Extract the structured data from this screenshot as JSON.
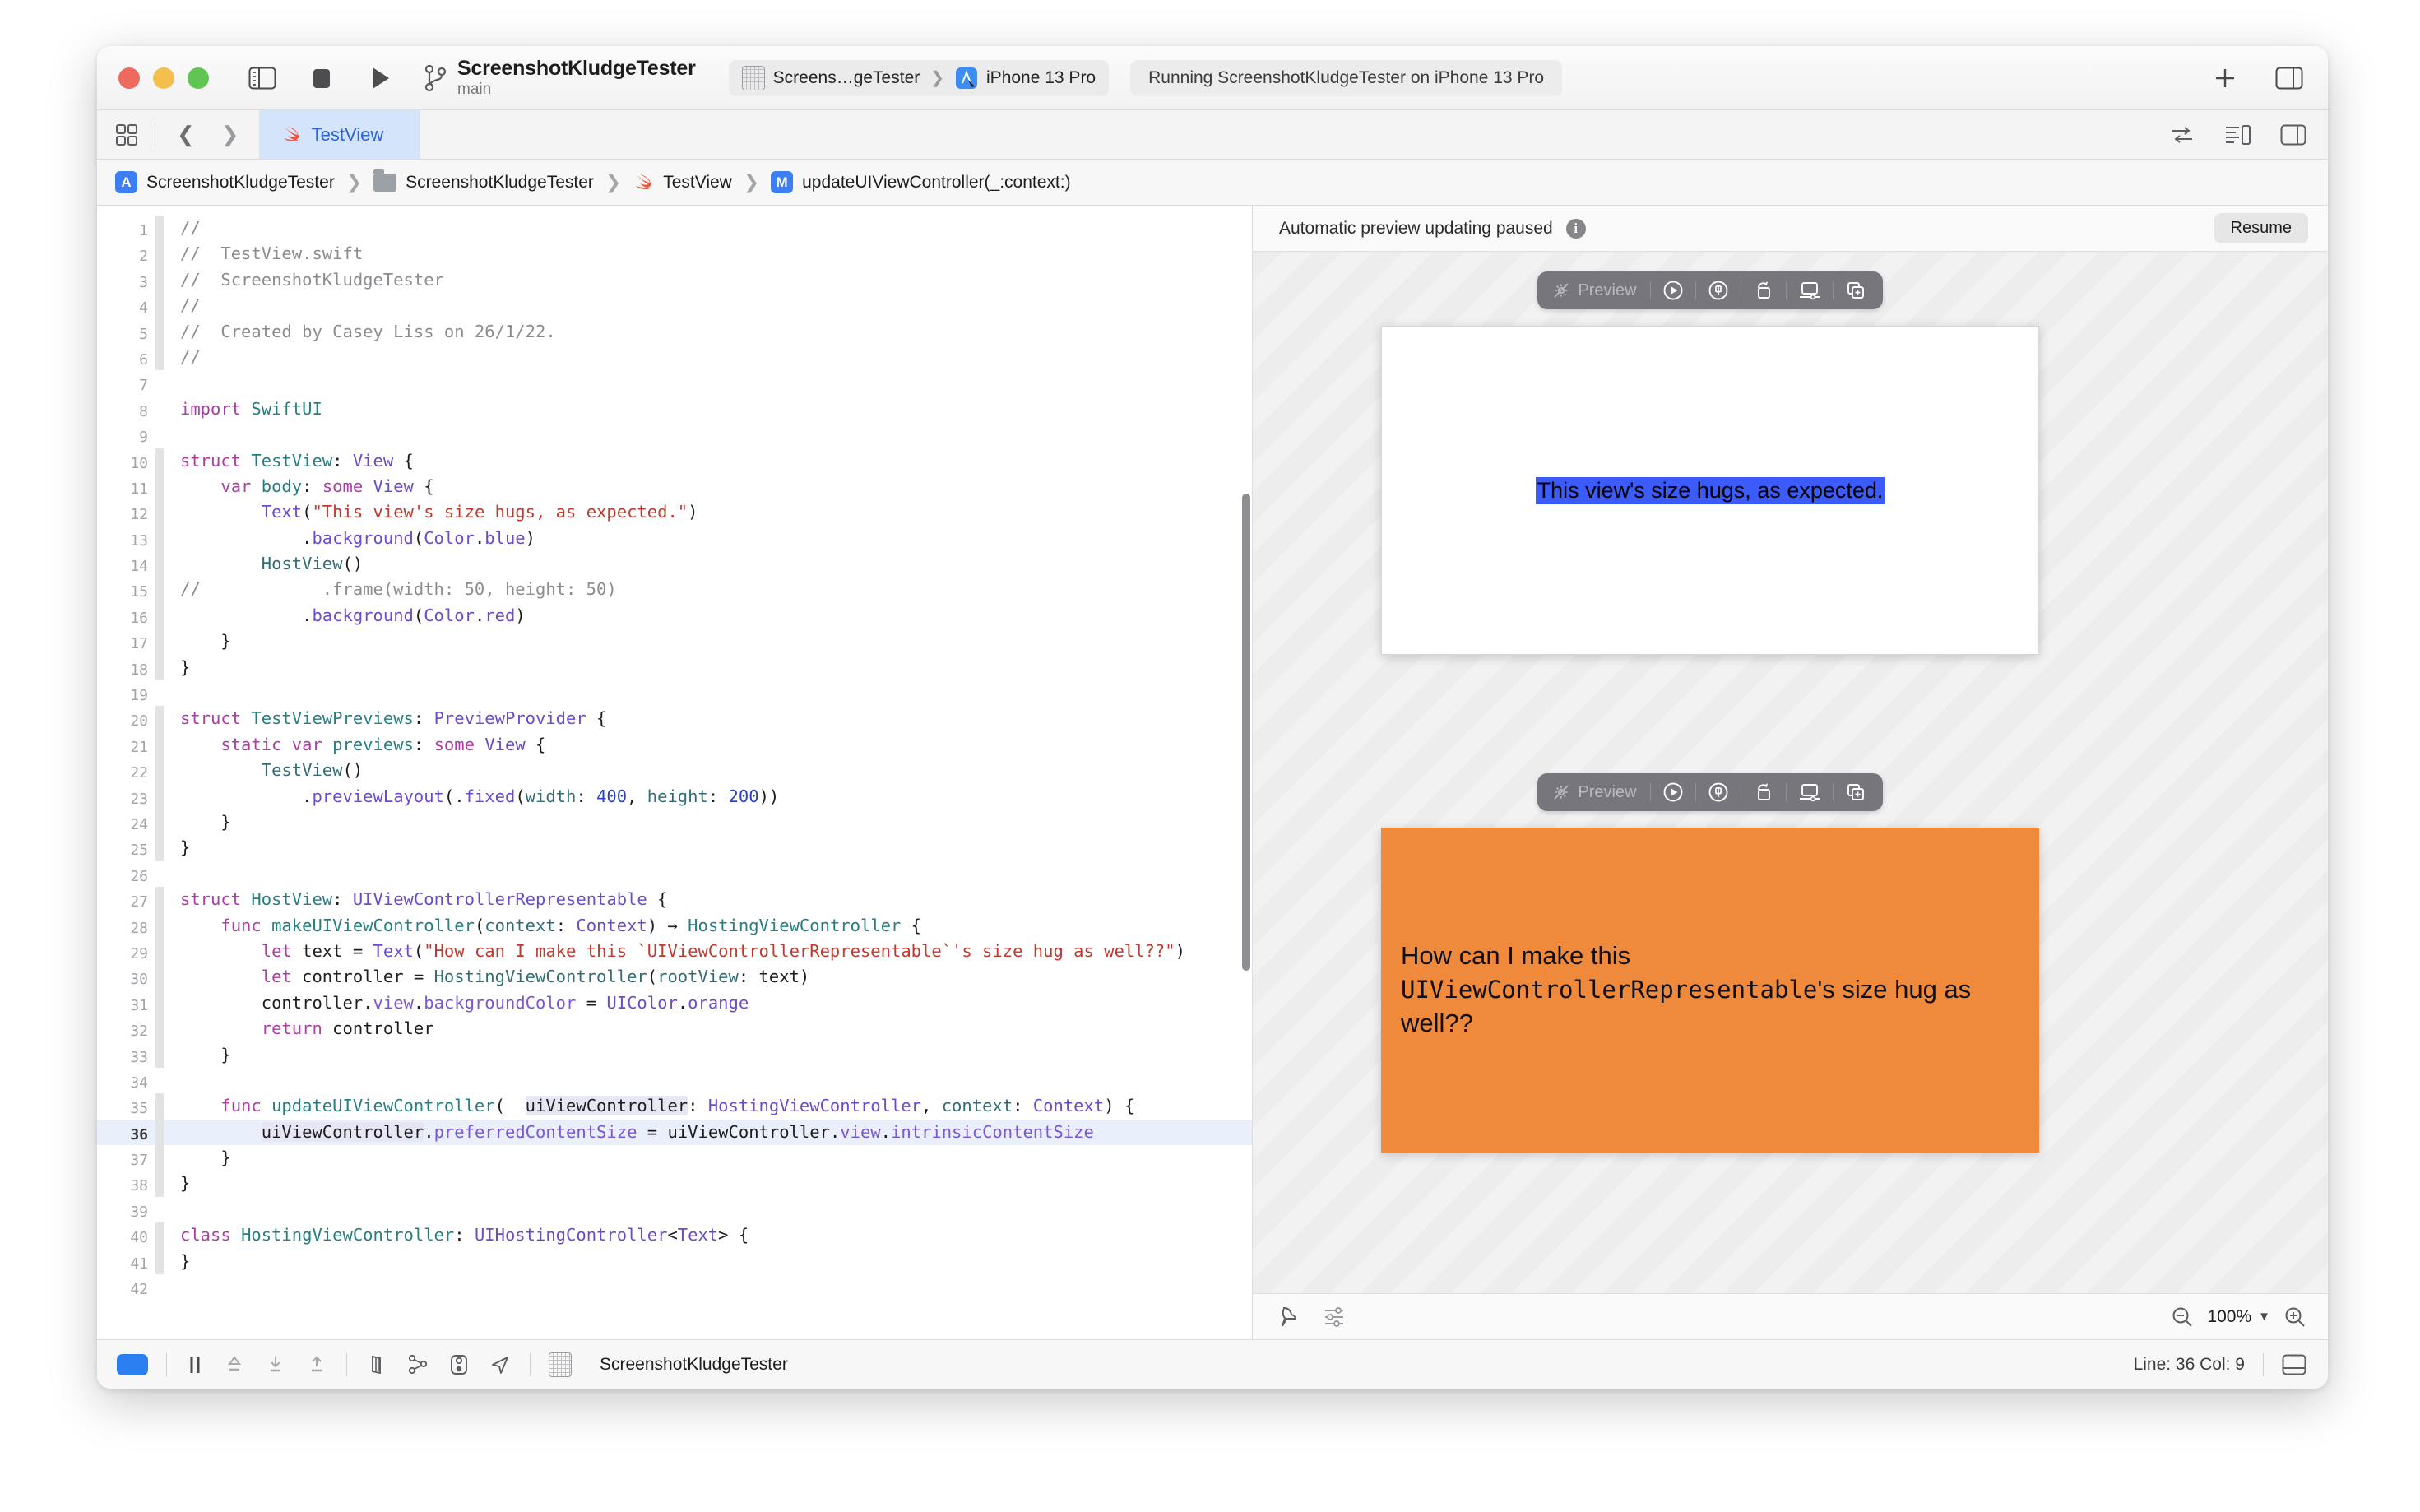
{
  "window": {
    "titlebar": {
      "scheme_title": "ScreenshotKludgeTester",
      "branch": "main",
      "scheme_name": "Screens…geTester",
      "destination": "iPhone 13 Pro",
      "status": "Running ScreenshotKludgeTester on iPhone 13 Pro",
      "add_label": "+"
    },
    "tabbar": {
      "tab_label": "TestView"
    },
    "jumpbar": {
      "crumbs": [
        {
          "label": "ScreenshotKludgeTester",
          "icon": "app-icon",
          "badge": "A"
        },
        {
          "label": "ScreenshotKludgeTester",
          "icon": "folder-icon",
          "badge": ""
        },
        {
          "label": "TestView",
          "icon": "swift-icon",
          "badge": ""
        },
        {
          "label": "updateUIViewController(_:context:)",
          "icon": "method-badge",
          "badge": "M"
        }
      ]
    }
  },
  "editor": {
    "lines": [
      {
        "n": 1,
        "fold": true,
        "tokens": [
          {
            "t": "//",
            "c": "cmt"
          }
        ]
      },
      {
        "n": 2,
        "fold": true,
        "tokens": [
          {
            "t": "//  TestView.swift",
            "c": "cmt"
          }
        ]
      },
      {
        "n": 3,
        "fold": true,
        "tokens": [
          {
            "t": "//  ScreenshotKludgeTester",
            "c": "cmt"
          }
        ]
      },
      {
        "n": 4,
        "fold": true,
        "tokens": [
          {
            "t": "//",
            "c": "cmt"
          }
        ]
      },
      {
        "n": 5,
        "fold": true,
        "tokens": [
          {
            "t": "//  Created by Casey Liss on 26/1/22.",
            "c": "cmt"
          }
        ]
      },
      {
        "n": 6,
        "fold": true,
        "tokens": [
          {
            "t": "//",
            "c": "cmt"
          }
        ]
      },
      {
        "n": 7,
        "fold": false,
        "tokens": []
      },
      {
        "n": 8,
        "fold": false,
        "tokens": [
          {
            "t": "import",
            "c": "kw"
          },
          {
            "t": " ",
            "c": "pln"
          },
          {
            "t": "SwiftUI",
            "c": "typ"
          }
        ]
      },
      {
        "n": 9,
        "fold": false,
        "tokens": []
      },
      {
        "n": 10,
        "fold": true,
        "tokens": [
          {
            "t": "struct",
            "c": "kw"
          },
          {
            "t": " ",
            "c": "pln"
          },
          {
            "t": "TestView",
            "c": "typ"
          },
          {
            "t": ": ",
            "c": "pln"
          },
          {
            "t": "View",
            "c": "meth"
          },
          {
            "t": " {",
            "c": "pln"
          }
        ]
      },
      {
        "n": 11,
        "fold": true,
        "tokens": [
          {
            "t": "    ",
            "c": "pln"
          },
          {
            "t": "var",
            "c": "kw"
          },
          {
            "t": " ",
            "c": "pln"
          },
          {
            "t": "body",
            "c": "typ"
          },
          {
            "t": ": ",
            "c": "pln"
          },
          {
            "t": "some",
            "c": "kw"
          },
          {
            "t": " ",
            "c": "pln"
          },
          {
            "t": "View",
            "c": "meth"
          },
          {
            "t": " {",
            "c": "pln"
          }
        ]
      },
      {
        "n": 12,
        "fold": true,
        "tokens": [
          {
            "t": "        ",
            "c": "pln"
          },
          {
            "t": "Text",
            "c": "meth"
          },
          {
            "t": "(",
            "c": "pln"
          },
          {
            "t": "\"This view's size hugs, as expected.\"",
            "c": "str"
          },
          {
            "t": ")",
            "c": "pln"
          }
        ]
      },
      {
        "n": 13,
        "fold": true,
        "tokens": [
          {
            "t": "            .",
            "c": "pln"
          },
          {
            "t": "background",
            "c": "meth"
          },
          {
            "t": "(",
            "c": "pln"
          },
          {
            "t": "Color",
            "c": "meth"
          },
          {
            "t": ".",
            "c": "pln"
          },
          {
            "t": "blue",
            "c": "meth"
          },
          {
            "t": ")",
            "c": "pln"
          }
        ]
      },
      {
        "n": 14,
        "fold": true,
        "tokens": [
          {
            "t": "        ",
            "c": "pln"
          },
          {
            "t": "HostView",
            "c": "ident"
          },
          {
            "t": "()",
            "c": "pln"
          }
        ]
      },
      {
        "n": 15,
        "fold": true,
        "tokens": [
          {
            "t": "//            .frame(width: 50, height: 50)",
            "c": "cmt"
          }
        ]
      },
      {
        "n": 16,
        "fold": true,
        "tokens": [
          {
            "t": "            .",
            "c": "pln"
          },
          {
            "t": "background",
            "c": "meth"
          },
          {
            "t": "(",
            "c": "pln"
          },
          {
            "t": "Color",
            "c": "meth"
          },
          {
            "t": ".",
            "c": "pln"
          },
          {
            "t": "red",
            "c": "meth"
          },
          {
            "t": ")",
            "c": "pln"
          }
        ]
      },
      {
        "n": 17,
        "fold": true,
        "tokens": [
          {
            "t": "    }",
            "c": "pln"
          }
        ]
      },
      {
        "n": 18,
        "fold": true,
        "tokens": [
          {
            "t": "}",
            "c": "pln"
          }
        ]
      },
      {
        "n": 19,
        "fold": false,
        "tokens": []
      },
      {
        "n": 20,
        "fold": true,
        "tokens": [
          {
            "t": "struct",
            "c": "kw"
          },
          {
            "t": " ",
            "c": "pln"
          },
          {
            "t": "TestViewPreviews",
            "c": "typ"
          },
          {
            "t": ": ",
            "c": "pln"
          },
          {
            "t": "PreviewProvider",
            "c": "meth"
          },
          {
            "t": " {",
            "c": "pln"
          }
        ]
      },
      {
        "n": 21,
        "fold": true,
        "tokens": [
          {
            "t": "    ",
            "c": "pln"
          },
          {
            "t": "static",
            "c": "kw"
          },
          {
            "t": " ",
            "c": "pln"
          },
          {
            "t": "var",
            "c": "kw"
          },
          {
            "t": " ",
            "c": "pln"
          },
          {
            "t": "previews",
            "c": "typ"
          },
          {
            "t": ": ",
            "c": "pln"
          },
          {
            "t": "some",
            "c": "kw"
          },
          {
            "t": " ",
            "c": "pln"
          },
          {
            "t": "View",
            "c": "meth"
          },
          {
            "t": " {",
            "c": "pln"
          }
        ]
      },
      {
        "n": 22,
        "fold": true,
        "tokens": [
          {
            "t": "        ",
            "c": "pln"
          },
          {
            "t": "TestView",
            "c": "ident"
          },
          {
            "t": "()",
            "c": "pln"
          }
        ]
      },
      {
        "n": 23,
        "fold": true,
        "tokens": [
          {
            "t": "            .",
            "c": "pln"
          },
          {
            "t": "previewLayout",
            "c": "meth"
          },
          {
            "t": "(.",
            "c": "pln"
          },
          {
            "t": "fixed",
            "c": "meth"
          },
          {
            "t": "(",
            "c": "pln"
          },
          {
            "t": "width",
            "c": "ident"
          },
          {
            "t": ": ",
            "c": "pln"
          },
          {
            "t": "400",
            "c": "num"
          },
          {
            "t": ", ",
            "c": "pln"
          },
          {
            "t": "height",
            "c": "ident"
          },
          {
            "t": ": ",
            "c": "pln"
          },
          {
            "t": "200",
            "c": "num"
          },
          {
            "t": "))",
            "c": "pln"
          }
        ]
      },
      {
        "n": 24,
        "fold": true,
        "tokens": [
          {
            "t": "    }",
            "c": "pln"
          }
        ]
      },
      {
        "n": 25,
        "fold": true,
        "tokens": [
          {
            "t": "}",
            "c": "pln"
          }
        ]
      },
      {
        "n": 26,
        "fold": false,
        "tokens": []
      },
      {
        "n": 27,
        "fold": true,
        "tokens": [
          {
            "t": "struct",
            "c": "kw"
          },
          {
            "t": " ",
            "c": "pln"
          },
          {
            "t": "HostView",
            "c": "typ"
          },
          {
            "t": ": ",
            "c": "pln"
          },
          {
            "t": "UIViewControllerRepresentable",
            "c": "meth"
          },
          {
            "t": " {",
            "c": "pln"
          }
        ]
      },
      {
        "n": 28,
        "fold": true,
        "tokens": [
          {
            "t": "    ",
            "c": "pln"
          },
          {
            "t": "func",
            "c": "kw"
          },
          {
            "t": " ",
            "c": "pln"
          },
          {
            "t": "makeUIViewController",
            "c": "typ"
          },
          {
            "t": "(",
            "c": "pln"
          },
          {
            "t": "context",
            "c": "ident"
          },
          {
            "t": ": ",
            "c": "pln"
          },
          {
            "t": "Context",
            "c": "meth"
          },
          {
            "t": ") ",
            "c": "pln"
          },
          {
            "t": "→",
            "c": "pln"
          },
          {
            "t": " ",
            "c": "pln"
          },
          {
            "t": "HostingViewController",
            "c": "typ"
          },
          {
            "t": " {",
            "c": "pln"
          }
        ]
      },
      {
        "n": 29,
        "fold": true,
        "tokens": [
          {
            "t": "        ",
            "c": "pln"
          },
          {
            "t": "let",
            "c": "kw"
          },
          {
            "t": " ",
            "c": "pln"
          },
          {
            "t": "text",
            "c": "pln"
          },
          {
            "t": " = ",
            "c": "pln"
          },
          {
            "t": "Text",
            "c": "meth"
          },
          {
            "t": "(",
            "c": "pln"
          },
          {
            "t": "\"How can I make this `UIViewControllerRepresentable`'s size hug as well??\"",
            "c": "str"
          },
          {
            "t": ")",
            "c": "pln"
          }
        ]
      },
      {
        "n": 30,
        "fold": true,
        "tokens": [
          {
            "t": "        ",
            "c": "pln"
          },
          {
            "t": "let",
            "c": "kw"
          },
          {
            "t": " ",
            "c": "pln"
          },
          {
            "t": "controller",
            "c": "pln"
          },
          {
            "t": " = ",
            "c": "pln"
          },
          {
            "t": "HostingViewController",
            "c": "ident"
          },
          {
            "t": "(",
            "c": "pln"
          },
          {
            "t": "rootView",
            "c": "ident"
          },
          {
            "t": ": ",
            "c": "pln"
          },
          {
            "t": "text",
            "c": "pln"
          },
          {
            "t": ")",
            "c": "pln"
          }
        ]
      },
      {
        "n": 31,
        "fold": true,
        "tokens": [
          {
            "t": "        ",
            "c": "pln"
          },
          {
            "t": "controller",
            "c": "pln"
          },
          {
            "t": ".",
            "c": "pln"
          },
          {
            "t": "view",
            "c": "prop"
          },
          {
            "t": ".",
            "c": "pln"
          },
          {
            "t": "backgroundColor",
            "c": "prop"
          },
          {
            "t": " = ",
            "c": "pln"
          },
          {
            "t": "UIColor",
            "c": "meth"
          },
          {
            "t": ".",
            "c": "pln"
          },
          {
            "t": "orange",
            "c": "meth"
          }
        ]
      },
      {
        "n": 32,
        "fold": true,
        "tokens": [
          {
            "t": "        ",
            "c": "pln"
          },
          {
            "t": "return",
            "c": "kw"
          },
          {
            "t": " ",
            "c": "pln"
          },
          {
            "t": "controller",
            "c": "pln"
          }
        ]
      },
      {
        "n": 33,
        "fold": true,
        "tokens": [
          {
            "t": "    }",
            "c": "pln"
          }
        ]
      },
      {
        "n": 34,
        "fold": false,
        "tokens": []
      },
      {
        "n": 35,
        "fold": true,
        "tokens": [
          {
            "t": "    ",
            "c": "pln"
          },
          {
            "t": "func",
            "c": "kw"
          },
          {
            "t": " ",
            "c": "pln"
          },
          {
            "t": "updateUIViewController",
            "c": "typ"
          },
          {
            "t": "(",
            "c": "pln"
          },
          {
            "t": "_",
            "c": "kw"
          },
          {
            "t": " ",
            "c": "pln"
          },
          {
            "t": "uiViewController",
            "c": "pln tokenhl"
          },
          {
            "t": ": ",
            "c": "pln"
          },
          {
            "t": "HostingViewController",
            "c": "meth"
          },
          {
            "t": ", ",
            "c": "pln"
          },
          {
            "t": "context",
            "c": "ident"
          },
          {
            "t": ": ",
            "c": "pln"
          },
          {
            "t": "Context",
            "c": "meth"
          },
          {
            "t": ") {",
            "c": "pln"
          }
        ]
      },
      {
        "n": 36,
        "fold": true,
        "current": true,
        "tokens": [
          {
            "t": "        ",
            "c": "pln"
          },
          {
            "t": "uiViewController",
            "c": "pln tokenhl"
          },
          {
            "t": ".",
            "c": "pln"
          },
          {
            "t": "preferredContentSize",
            "c": "prop"
          },
          {
            "t": " = ",
            "c": "pln"
          },
          {
            "t": "uiViewController",
            "c": "pln"
          },
          {
            "t": ".",
            "c": "pln"
          },
          {
            "t": "view",
            "c": "prop"
          },
          {
            "t": ".",
            "c": "pln"
          },
          {
            "t": "intrinsicContentSize",
            "c": "prop"
          }
        ]
      },
      {
        "n": 37,
        "fold": true,
        "tokens": [
          {
            "t": "    }",
            "c": "pln"
          }
        ]
      },
      {
        "n": 38,
        "fold": true,
        "tokens": [
          {
            "t": "}",
            "c": "pln"
          }
        ]
      },
      {
        "n": 39,
        "fold": false,
        "tokens": []
      },
      {
        "n": 40,
        "fold": true,
        "tokens": [
          {
            "t": "class",
            "c": "kw"
          },
          {
            "t": " ",
            "c": "pln"
          },
          {
            "t": "HostingViewController",
            "c": "typ"
          },
          {
            "t": ": ",
            "c": "pln"
          },
          {
            "t": "UIHostingController",
            "c": "meth"
          },
          {
            "t": "<",
            "c": "pln"
          },
          {
            "t": "Text",
            "c": "meth"
          },
          {
            "t": "> {",
            "c": "pln"
          }
        ]
      },
      {
        "n": 41,
        "fold": true,
        "tokens": [
          {
            "t": "}",
            "c": "pln"
          }
        ]
      },
      {
        "n": 42,
        "fold": false,
        "tokens": []
      }
    ]
  },
  "canvas": {
    "banner_text": "Automatic preview updating paused",
    "resume_label": "Resume",
    "toolbar": {
      "preview_label": "Preview",
      "icons": [
        "live-preview-icon",
        "play-circle-icon",
        "inspect-circle-icon",
        "orientation-icon",
        "device-settings-icon",
        "duplicate-preview-icon"
      ]
    },
    "previews": [
      {
        "text": "This view's size hugs, as expected."
      },
      {
        "text_before": "How can I make this ",
        "text_mono": "UIViewControllerRepresentable",
        "text_after": "'s size hug as well??"
      }
    ],
    "zoom_value": "100%"
  },
  "statusbar": {
    "project": "ScreenshotKludgeTester",
    "line_col": "Line: 36  Col: 9"
  },
  "colors": {
    "accent_blue": "#2b7ef0",
    "tab_selected": "#d4e4fb",
    "preview_orange": "#ef8a3c",
    "preview_blue": "#3b5bfa",
    "swift_orange": "#f05138"
  }
}
